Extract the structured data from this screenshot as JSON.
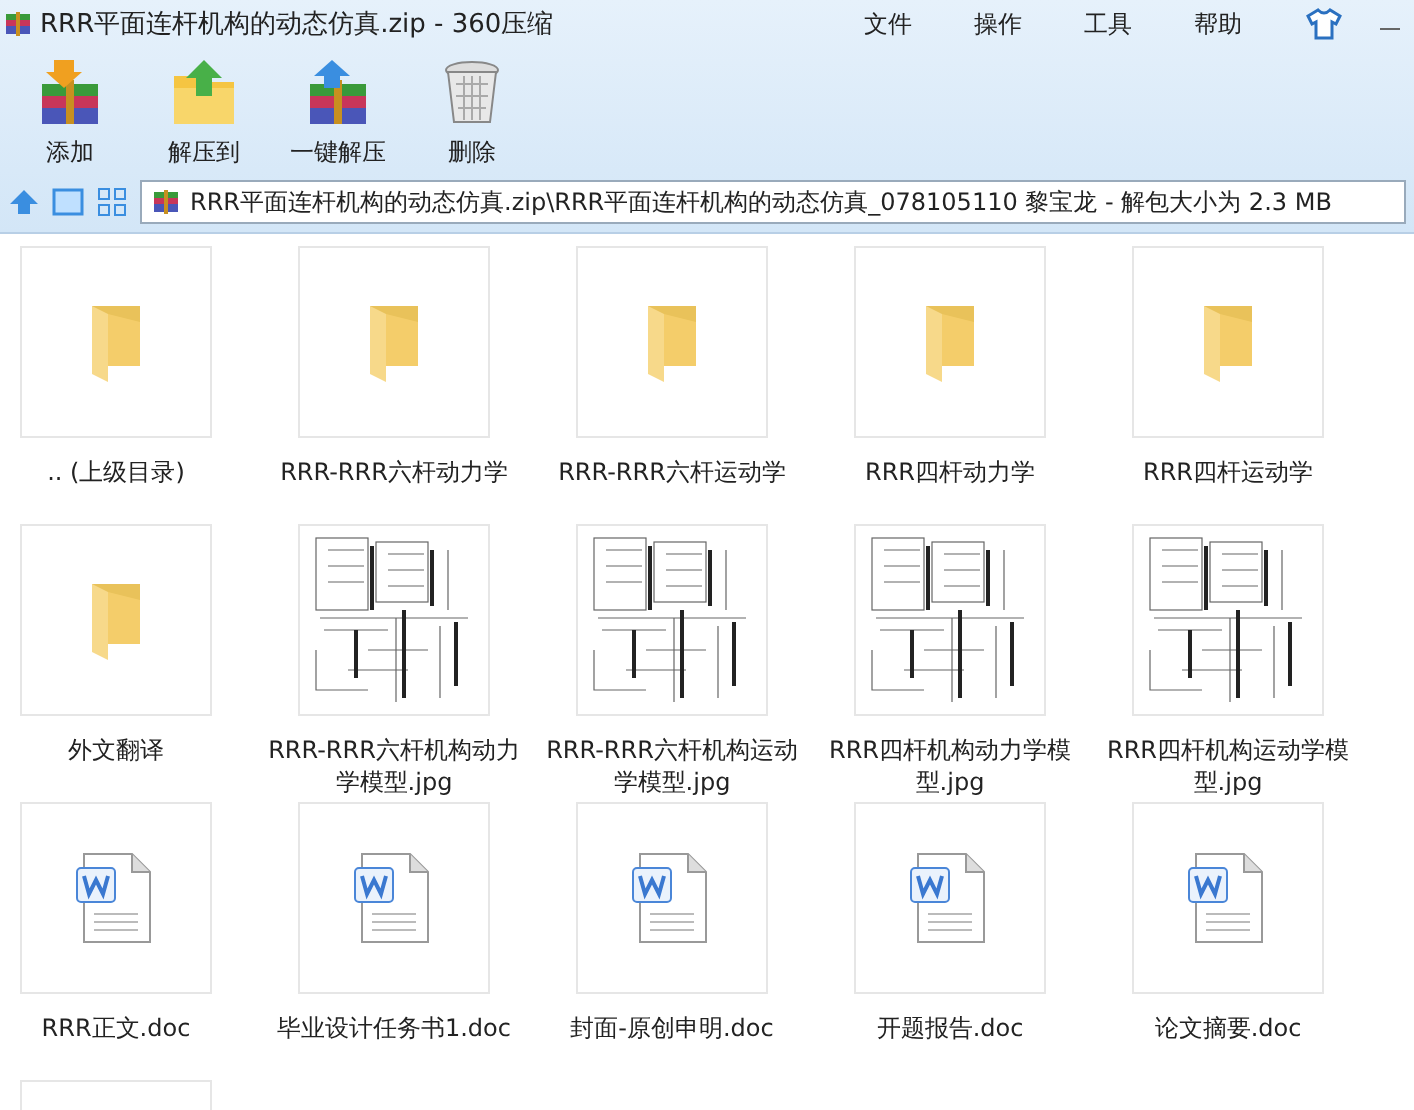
{
  "window": {
    "title": "RRR平面连杆机构的动态仿真.zip - 360压缩"
  },
  "menu": [
    "文件",
    "操作",
    "工具",
    "帮助"
  ],
  "toolbar": [
    {
      "kind": "add",
      "label": "添加"
    },
    {
      "kind": "extract_to",
      "label": "解压到"
    },
    {
      "kind": "quick_extract",
      "label": "一键解压"
    },
    {
      "kind": "delete",
      "label": "删除"
    }
  ],
  "address_bar": {
    "path": "RRR平面连杆机构的动态仿真.zip\\RRR平面连杆机构的动态仿真_078105110 黎宝龙 - 解包大小为 2.3 MB"
  },
  "items": [
    {
      "kind": "folder",
      "name": ".. (上级目录)"
    },
    {
      "kind": "folder",
      "name": "RRR-RRR六杆动力学"
    },
    {
      "kind": "folder",
      "name": "RRR-RRR六杆运动学"
    },
    {
      "kind": "folder",
      "name": "RRR四杆动力学"
    },
    {
      "kind": "folder",
      "name": "RRR四杆运动学"
    },
    {
      "kind": "folder",
      "name": "外文翻译"
    },
    {
      "kind": "image",
      "name": "RRR-RRR六杆机构动力学模型.jpg"
    },
    {
      "kind": "image",
      "name": "RRR-RRR六杆机构运动学模型.jpg"
    },
    {
      "kind": "image",
      "name": "RRR四杆机构动力学模型.jpg"
    },
    {
      "kind": "image",
      "name": "RRR四杆机构运动学模型.jpg"
    },
    {
      "kind": "doc",
      "name": "RRR正文.doc"
    },
    {
      "kind": "doc",
      "name": "毕业设计任务书1.doc"
    },
    {
      "kind": "doc",
      "name": "封面-原创申明.doc"
    },
    {
      "kind": "doc",
      "name": "开题报告.doc"
    },
    {
      "kind": "doc",
      "name": "论文摘要.doc"
    },
    {
      "kind": "blank"
    }
  ]
}
